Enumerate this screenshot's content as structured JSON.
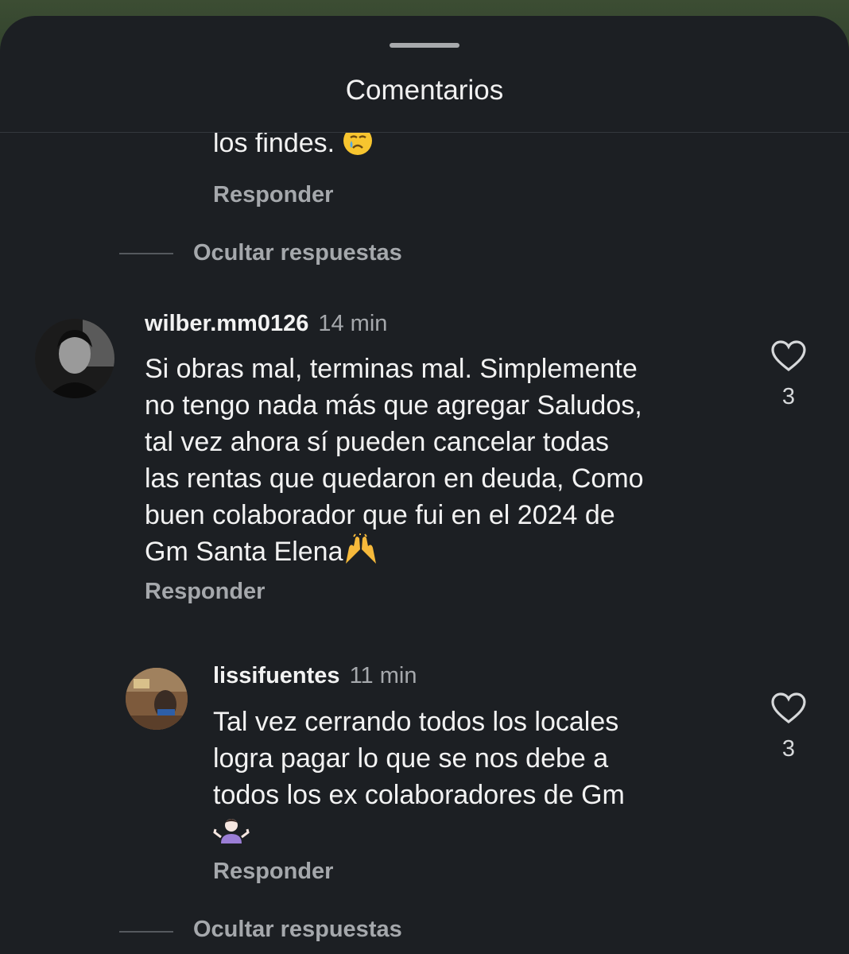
{
  "sheet": {
    "title": "Comentarios"
  },
  "partial_comment": {
    "text_tail": "los findes.",
    "emoji": "crying-face",
    "reply_label": "Responder"
  },
  "hide_replies_top": {
    "label": "Ocultar respuestas"
  },
  "comment_main": {
    "username": "wilber.mm0126",
    "time": "14 min",
    "lines": [
      "Si obras mal, terminas mal. Simplemente",
      "no tengo nada más que agregar Saludos,",
      "tal vez ahora sí pueden cancelar todas",
      "las rentas que quedaron en deuda, Como",
      "buen colaborador que fui en el 2024 de",
      "Gm Santa Elena"
    ],
    "emoji": "raising-hands",
    "reply_label": "Responder",
    "likes": "3"
  },
  "comment_reply": {
    "username": "lissifuentes",
    "time": "11 min",
    "lines": [
      "Tal vez cerrando todos los locales",
      "logra pagar lo que se nos debe a",
      "todos los ex colaboradores de Gm"
    ],
    "emoji": "person-shrugging",
    "reply_label": "Responder",
    "likes": "3"
  },
  "hide_replies_bottom": {
    "label": "Ocultar respuestas"
  },
  "colors": {
    "sheet_bg": "#1c1f23",
    "text": "#f2f2f2",
    "muted": "#a5a8ac"
  }
}
